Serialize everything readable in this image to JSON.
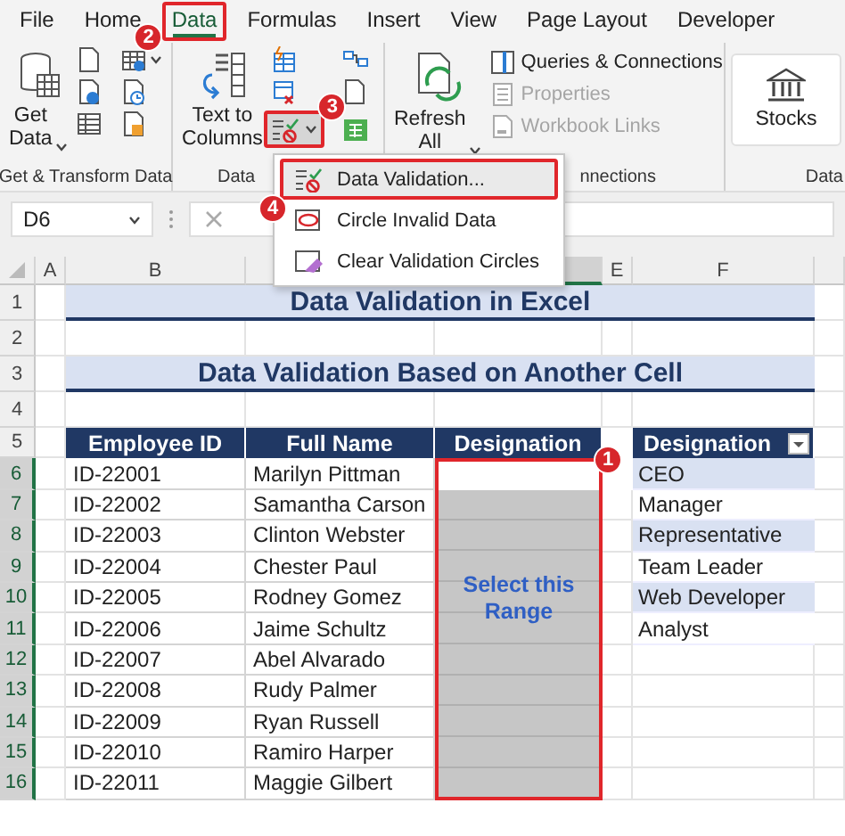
{
  "ribbon_tabs": [
    {
      "label": "File",
      "selected": false,
      "highlighted": false
    },
    {
      "label": "Home",
      "selected": false,
      "highlighted": false
    },
    {
      "label": "Data",
      "selected": true,
      "highlighted": true,
      "badge": "2"
    },
    {
      "label": "Formulas",
      "selected": false,
      "highlighted": false
    },
    {
      "label": "Insert",
      "selected": false,
      "highlighted": false
    },
    {
      "label": "View",
      "selected": false,
      "highlighted": false
    },
    {
      "label": "Page Layout",
      "selected": false,
      "highlighted": false
    },
    {
      "label": "Developer",
      "selected": false,
      "highlighted": false
    }
  ],
  "ribbon_groups": [
    {
      "kind": "get",
      "label": "Get & Transform Data",
      "large": {
        "lines": [
          "Get",
          "Data"
        ],
        "dropdown": true
      }
    },
    {
      "kind": "tools",
      "label": "Data",
      "large": {
        "lines": [
          "Text to",
          "Columns"
        ],
        "dropdown": false
      },
      "validation_button": {
        "highlighted": true,
        "badge": "3"
      }
    },
    {
      "kind": "queries",
      "label": "nnections",
      "large": {
        "lines": [
          "Refresh",
          "All"
        ],
        "dropdown": true
      },
      "items": [
        {
          "label": "Queries & Connections",
          "disabled": false
        },
        {
          "label": "Properties",
          "disabled": true
        },
        {
          "label": "Workbook Links",
          "disabled": true
        }
      ]
    },
    {
      "kind": "types",
      "label": "Data",
      "large": {
        "lines": [
          "Stocks"
        ],
        "dropdown": false
      }
    }
  ],
  "formula_bar": {
    "name_box": "D6"
  },
  "validation_menu": [
    {
      "label": "Data Validation...",
      "highlighted": true,
      "badge": "4"
    },
    {
      "label": "Circle Invalid Data",
      "highlighted": false
    },
    {
      "label": "Clear Validation Circles",
      "highlighted": false
    }
  ],
  "sheet": {
    "columns": [
      {
        "label": "A",
        "selected": false
      },
      {
        "label": "B",
        "selected": false
      },
      {
        "selected": false
      },
      {
        "selected": true
      },
      {
        "label": "E",
        "selected": false
      },
      {
        "label": "F",
        "selected": false
      }
    ],
    "rows": [
      {
        "label": "1",
        "selected": false
      },
      {
        "label": "2",
        "selected": false
      },
      {
        "label": "3",
        "selected": false
      },
      {
        "label": "4",
        "selected": false
      },
      {
        "label": "5",
        "selected": false
      },
      {
        "label": "6",
        "selected": true
      },
      {
        "label": "7",
        "selected": true
      },
      {
        "label": "8",
        "selected": true
      },
      {
        "label": "9",
        "selected": true
      },
      {
        "label": "10",
        "selected": true
      },
      {
        "label": "11",
        "selected": true
      },
      {
        "label": "12",
        "selected": true
      },
      {
        "label": "13",
        "selected": true
      },
      {
        "label": "14",
        "selected": true
      },
      {
        "label": "15",
        "selected": true
      },
      {
        "label": "16",
        "selected": true
      }
    ],
    "title": "Data Validation in Excel",
    "subtitle": "Data Validation Based on Another Cell",
    "table": {
      "columns": [
        "Employee ID",
        "Full Name",
        "Designation"
      ],
      "badge": "1",
      "range_note": "Select this Range",
      "range_highlighted": true,
      "rows": [
        {
          "employee_id": "ID-22001",
          "full_name": "Marilyn Pittman",
          "active": true
        },
        {
          "employee_id": "ID-22002",
          "full_name": "Samantha Carson",
          "active": false
        },
        {
          "employee_id": "ID-22003",
          "full_name": "Clinton Webster",
          "active": false
        },
        {
          "employee_id": "ID-22004",
          "full_name": "Chester Paul",
          "active": false
        },
        {
          "employee_id": "ID-22005",
          "full_name": "Rodney Gomez",
          "active": false
        },
        {
          "employee_id": "ID-22006",
          "full_name": "Jaime Schultz",
          "active": false
        },
        {
          "employee_id": "ID-22007",
          "full_name": "Abel Alvarado",
          "active": false
        },
        {
          "employee_id": "ID-22008",
          "full_name": "Rudy Palmer",
          "active": false
        },
        {
          "employee_id": "ID-22009",
          "full_name": "Ryan Russell",
          "active": false
        },
        {
          "employee_id": "ID-22010",
          "full_name": "Ramiro Harper",
          "active": false
        },
        {
          "employee_id": "ID-22011",
          "full_name": "Maggie Gilbert",
          "active": false
        }
      ]
    },
    "list": {
      "header": "Designation",
      "filter": true,
      "items": [
        "CEO",
        "Manager",
        "Representative",
        "Team Leader",
        "Web Developer",
        "Analyst"
      ]
    }
  }
}
